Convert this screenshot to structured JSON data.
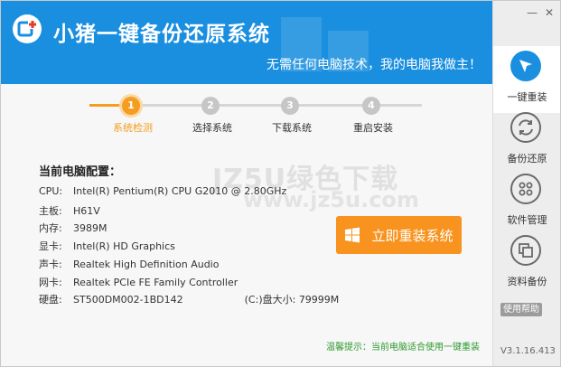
{
  "header": {
    "title": "小猪一键备份还原系统",
    "slogan": "无需任何电脑技术，我的电脑我做主！"
  },
  "steps": [
    {
      "num": "1",
      "label": "系统检测",
      "active": true
    },
    {
      "num": "2",
      "label": "选择系统",
      "active": false
    },
    {
      "num": "3",
      "label": "下载系统",
      "active": false
    },
    {
      "num": "4",
      "label": "重启安装",
      "active": false
    }
  ],
  "config": {
    "title": "当前电脑配置：",
    "rows": [
      {
        "key": "CPU:",
        "value": "Intel(R) Pentium(R) CPU G2010 @ 2.80GHz"
      },
      {
        "key": "主板:",
        "value": "H61V"
      },
      {
        "key": "内存:",
        "value": "3989M"
      },
      {
        "key": "显卡:",
        "value": "Intel(R) HD Graphics"
      },
      {
        "key": "声卡:",
        "value": "Realtek High Definition Audio"
      },
      {
        "key": "网卡:",
        "value": "Realtek PCIe FE Family Controller"
      },
      {
        "key": "硬盘:",
        "value": "ST500DM002-1BD142",
        "extra": "(C:)盘大小: 79999M"
      }
    ]
  },
  "reinstall_button": "立即重装系统",
  "watermark": {
    "line1": "JZ5U绿色下载",
    "line2": "www.jz5u.com"
  },
  "tip": "温馨提示：当前电脑适合使用一键重装",
  "sidebar": {
    "items": [
      {
        "label": "一键重装",
        "icon": "cursor-icon",
        "active": true
      },
      {
        "label": "备份还原",
        "icon": "refresh-icon",
        "active": false
      },
      {
        "label": "软件管理",
        "icon": "apps-grid-icon",
        "active": false
      },
      {
        "label": "资料备份",
        "icon": "copy-icon",
        "active": false
      }
    ],
    "help": "使用帮助",
    "version": "V3.1.16.413"
  },
  "colors": {
    "brand_blue": "#1a8fe0",
    "accent_orange": "#f7931e",
    "tip_green": "#2e9a2e"
  }
}
